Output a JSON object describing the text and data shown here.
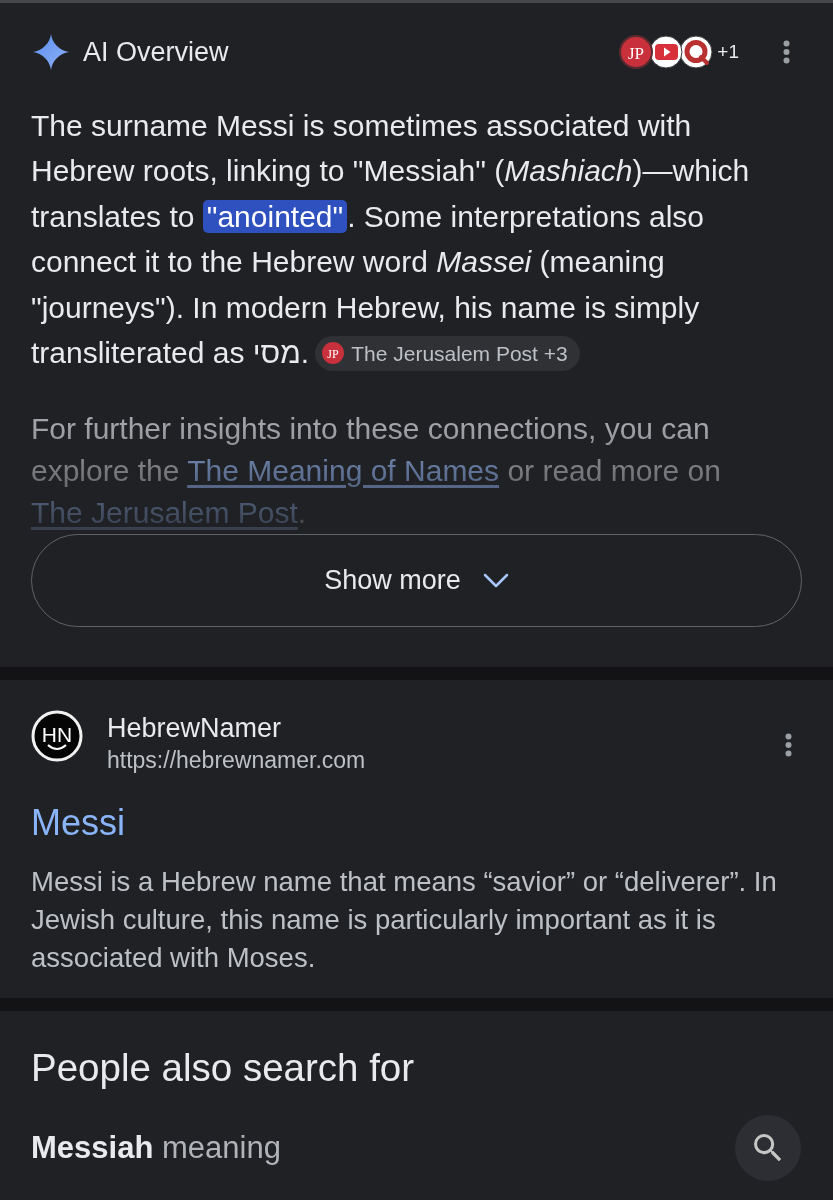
{
  "overview": {
    "title": "AI Overview",
    "sources": [
      {
        "kind": "jp",
        "label": "JP"
      },
      {
        "kind": "video"
      },
      {
        "kind": "ring"
      }
    ],
    "more_sources": "+1",
    "paragraphs": [
      {
        "faded": false,
        "parts": [
          {
            "kind": "text",
            "text": "The surname Messi is sometimes associated with Hebrew roots, linking to \"Messiah\" (*Mashiach*)—which translates to "
          },
          {
            "kind": "highlight",
            "text": "\"anointed\""
          },
          {
            "kind": "text",
            "text": ". Some interpretations also connect it to the Hebrew word *Massei* (meaning \"journeys\"). In modern Hebrew, his name is simply transliterated as מסי."
          },
          {
            "kind": "citation",
            "logo": "JP",
            "text": "The Jerusalem Post +3"
          }
        ]
      },
      {
        "faded": true,
        "parts": [
          {
            "kind": "text",
            "text": "For further insights into these connections, you can explore the "
          },
          {
            "kind": "link",
            "text": "The Meaning of Names"
          },
          {
            "kind": "text",
            "text": " or read more on "
          },
          {
            "kind": "link",
            "text": "The Jerusalem Post"
          },
          {
            "kind": "text",
            "text": "."
          }
        ]
      }
    ],
    "show_more": "Show more"
  },
  "result": {
    "favicon": "HN",
    "site": "HebrewNamer",
    "url": "https://hebrewnamer.com",
    "title": "Messi",
    "snippet": "Messi is a Hebrew name that means “savior” or “deliverer”. In Jewish culture, this name is particularly important as it is associated with Moses."
  },
  "related": {
    "title": "People also search for",
    "items": [
      {
        "text": "**Messiah** meaning"
      }
    ]
  }
}
